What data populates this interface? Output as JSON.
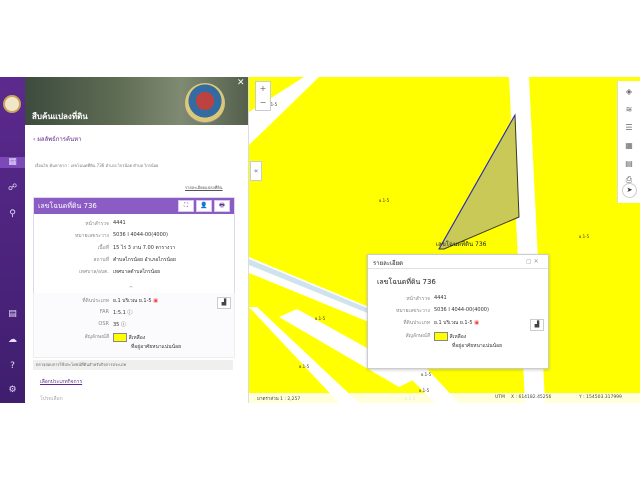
{
  "panel": {
    "title": "สืบค้นแปลงที่ดิน",
    "close": "✕",
    "back_label": "ผลลัพธ์การค้นหา",
    "description": "เงื่อนไข ค้นหาจาก : เลขโฉนดที่ดิน 736 อำเภอ ไกรน้อย ตำบล ไกรน้อย",
    "map_link": "รายละเอียดแปลงที่ดิน"
  },
  "card": {
    "title": "เลขโฉนดที่ดิน 736",
    "buttons": [
      "⛶",
      "👤",
      "🖶"
    ],
    "rows": [
      {
        "key": "หน้าสำรวจ",
        "value": "4441"
      },
      {
        "key": "หมายเลขระวาง",
        "value": "5036 I 4044-00(4000)"
      },
      {
        "key": "เนื้อที่",
        "value": "15 ไร่ 3 งาน 7.00 ตารางวา"
      },
      {
        "key": "สถานที่",
        "value": "ตำบลไกรน้อย อำเภอไกรน้อย"
      },
      {
        "key": "เทศบาล/อบต.",
        "value": "เทศบาลตำบลไกรน้อย"
      }
    ],
    "chevron": "^",
    "landuse_key": "ที่ดินประเภท",
    "landuse_value": "ย.1 บริเวณ ย.1-5",
    "far_key": "FAR",
    "far_value": "1:5.1",
    "osr_key": "OSR",
    "osr_value": "35",
    "color_key": "สัญลักษณ์สี",
    "color_name": "สีเหลือง",
    "color_desc": "ที่อยู่อาศัยหนาแน่นน้อย",
    "check_label": "ตรวจสอบการใช้ประโยชน์ที่ดินสำหรับกิจการประเภท",
    "detail_link": "เลือกประเภทกิจการ",
    "select_placeholder": "โปรดเลือก"
  },
  "map": {
    "zoom_in": "+",
    "zoom_out": "−",
    "collapse": "«",
    "parcel_label": "เลขโฉนดที่ดิน 736",
    "zone_labels": [
      "ย.1-5",
      "ย.1-5",
      "ย.1-5",
      "ย.1-5",
      "ย.1-5",
      "ย.1-5",
      "ย.1-5",
      "ย.1-5"
    ],
    "scale_text": "มาตราส่วน 1 : 2,257",
    "coord_label": "UTM",
    "coord_x": "X : 614182.45256",
    "coord_y": "Y : 154503.317999",
    "tools": [
      "layers-icon",
      "stack-icon",
      "list-icon",
      "grid-icon",
      "table-icon",
      "print-icon"
    ],
    "compass": "➤"
  },
  "popup": {
    "title": "รายละเอียด",
    "controls": "▢  ✕",
    "deed": "เลขโฉนดที่ดิน 736",
    "rows": [
      {
        "key": "หน้าสำรวจ",
        "value": "4441"
      },
      {
        "key": "หมายเลขระวาง",
        "value": "5036 I 4044-00(4000)"
      },
      {
        "key": "ที่ดินประเภท",
        "value": "ย.1 บริเวณ ย.1-5"
      }
    ],
    "color_key": "สัญลักษณ์สี",
    "color_name": "สีเหลือง",
    "color_desc": "ที่อยู่อาศัยหนาแน่นน้อย"
  },
  "colors": {
    "brand": "#5b2a8e",
    "card_header": "#8a5cc4",
    "zone_yellow": "#ffff00",
    "parcel_fill": "#c9c957"
  }
}
